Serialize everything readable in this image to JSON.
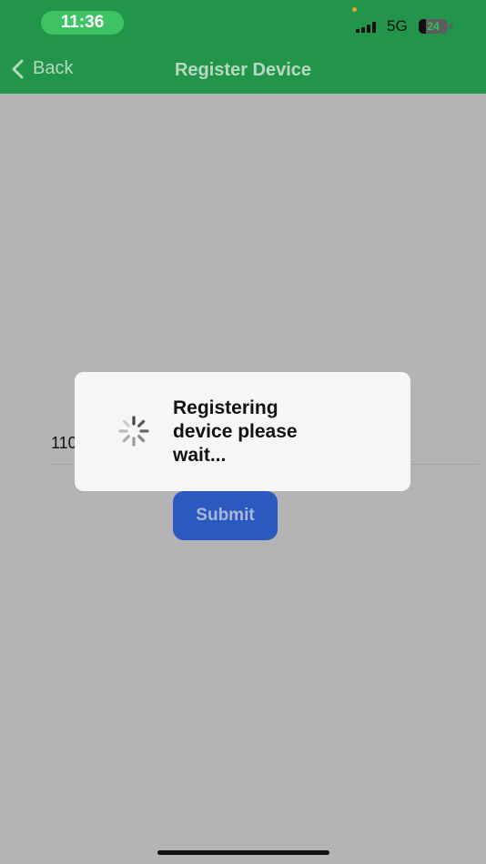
{
  "status_bar": {
    "time": "11:36",
    "network": "5G",
    "battery": "24",
    "battery_level": 0.24,
    "accent_color": "#3ec363",
    "indicator_color": "#f0a21b"
  },
  "nav": {
    "back_label": "Back",
    "title": "Register Device",
    "bar_color": "#23954a"
  },
  "form": {
    "serial_value": "110",
    "submit_label": "Submit",
    "submit_color": "#2c59c0"
  },
  "dialog": {
    "message_lines": [
      "Registering",
      "device please",
      "wait..."
    ],
    "spinner_icon": "spinner-icon"
  }
}
